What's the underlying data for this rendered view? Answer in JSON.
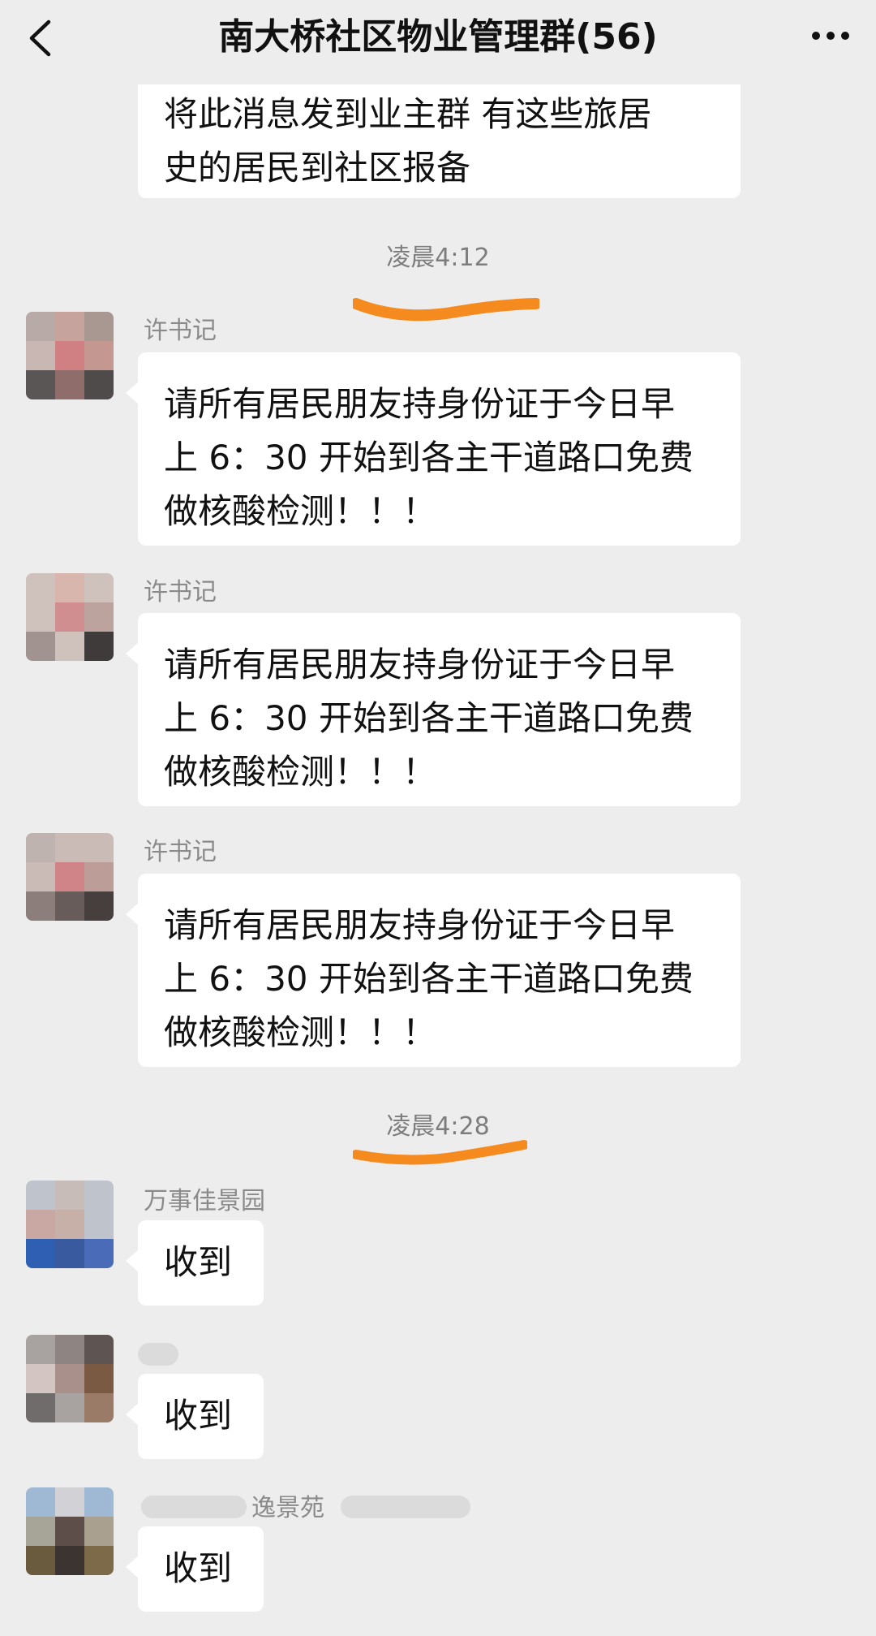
{
  "header": {
    "title": "南大桥社区物业管理群(56)"
  },
  "messages": [
    {
      "text": "将此消息发到业主群 有这些旅居\n史的居民到社区报备"
    },
    {
      "time": "凌晨4:12"
    },
    {
      "sender": "许书记",
      "text": "请所有居民朋友持身份证于今日早\n上 6：30 开始到各主干道路口免费\n做核酸检测！！！"
    },
    {
      "sender": "许书记",
      "text": "请所有居民朋友持身份证于今日早\n上 6：30 开始到各主干道路口免费\n做核酸检测！！！"
    },
    {
      "sender": "许书记",
      "text": "请所有居民朋友持身份证于今日早\n上 6：30 开始到各主干道路口免费\n做核酸检测！！！"
    },
    {
      "time": "凌晨4:28"
    },
    {
      "sender": "万事佳景园",
      "text": "收到"
    },
    {
      "sender": "",
      "text": "收到"
    },
    {
      "sender": "逸景苑",
      "text": "收到"
    }
  ],
  "colors": {
    "background": "#ededed",
    "bubble": "#ffffff",
    "highlight_underline": "#f58a1f"
  },
  "icons": {
    "back": "chevron-left-icon",
    "more": "more-dots-icon"
  }
}
